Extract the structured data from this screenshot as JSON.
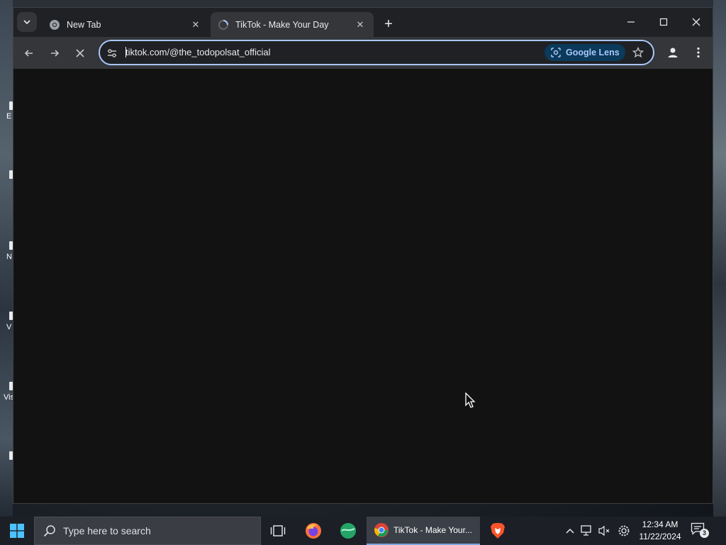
{
  "desktop": {
    "labels": [
      "E",
      "N",
      "V",
      "Vis"
    ]
  },
  "browser": {
    "tabs": [
      {
        "title": "New Tab",
        "state": "inactive",
        "icon": "chrome-icon"
      },
      {
        "title": "TikTok - Make Your Day",
        "state": "active-loading",
        "icon": "loading-spinner-icon"
      }
    ],
    "omnibox": {
      "url": "tiktok.com/@the_todopolsat_official",
      "lens_label": "Google Lens"
    },
    "colors": {
      "content_bg": "#121212",
      "omnibox_border": "#a8c7fa",
      "lens_bg": "#0b3a5a"
    }
  },
  "taskbar": {
    "search_placeholder": "Type here to search",
    "chrome_task_label": "TikTok - Make Your...",
    "clock_time": "12:34 AM",
    "clock_date": "11/22/2024",
    "notification_count": "3"
  }
}
